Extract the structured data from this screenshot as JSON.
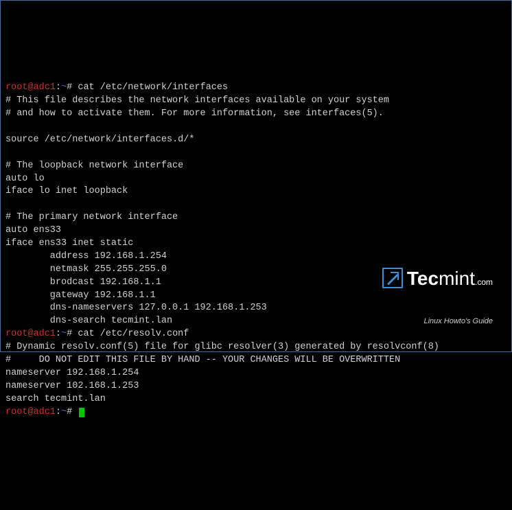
{
  "prompt": {
    "user_host": "root@adc1",
    "colon": ":",
    "path": "~",
    "hash": "#"
  },
  "commands": {
    "cmd1": "cat /etc/network/interfaces",
    "cmd2": "cat /etc/resolv.conf"
  },
  "output1": {
    "l1": "# This file describes the network interfaces available on your system",
    "l2": "# and how to activate them. For more information, see interfaces(5).",
    "l3": "",
    "l4": "source /etc/network/interfaces.d/*",
    "l5": "",
    "l6": "# The loopback network interface",
    "l7": "auto lo",
    "l8": "iface lo inet loopback",
    "l9": "",
    "l10": "# The primary network interface",
    "l11": "auto ens33",
    "l12": "iface ens33 inet static",
    "l13": "        address 192.168.1.254",
    "l14": "        netmask 255.255.255.0",
    "l15": "        brodcast 192.168.1.1",
    "l16": "        gateway 192.168.1.1",
    "l17": "        dns-nameservers 127.0.0.1 192.168.1.253",
    "l18": "        dns-search tecmint.lan"
  },
  "output2": {
    "l1": "# Dynamic resolv.conf(5) file for glibc resolver(3) generated by resolvconf(8)",
    "l2": "#     DO NOT EDIT THIS FILE BY HAND -- YOUR CHANGES WILL BE OVERWRITTEN",
    "l3": "nameserver 192.168.1.254",
    "l4": "nameserver 102.168.1.253",
    "l5": "search tecmint.lan"
  },
  "watermark": {
    "brand_bold": "Tec",
    "brand_rest": "mint",
    "dotcom": ".com",
    "tagline": "Linux Howto's Guide"
  }
}
